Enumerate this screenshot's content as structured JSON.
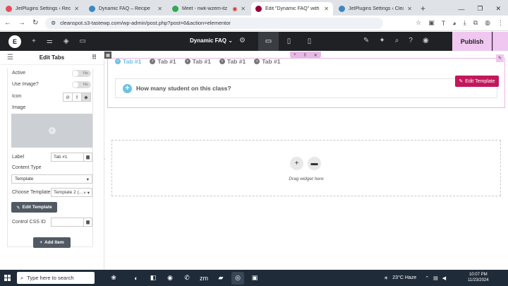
{
  "browser": {
    "tabs": [
      {
        "title": "JetPlugins Settings › Recipe",
        "color": "#e54e59",
        "active": false
      },
      {
        "title": "Dynamic FAQ – Recipe",
        "color": "#3b88c3",
        "active": false
      },
      {
        "title": "Meet - nwk-wzem-itz",
        "color": "#34a853",
        "active": false
      },
      {
        "title": "Edit \"Dynamic FAQ\" with Ele",
        "color": "#92003b",
        "active": true
      },
      {
        "title": "JetPlugins Settings ‹ Clean S",
        "color": "#3b88c3",
        "active": false
      }
    ],
    "url": "cleanspot.s3-tastewp.com/wp-admin/post.php?post=6&action=elementor"
  },
  "editor": {
    "document_name": "Dynamic FAQ",
    "publish_label": "Publish"
  },
  "panel": {
    "title": "Edit Tabs",
    "active_label": "Active",
    "active_toggle": "No",
    "use_image_label": "Use Image?",
    "use_image_toggle": "No",
    "icon_label": "Icon",
    "image_label": "Image",
    "label_label": "Label",
    "label_value": "Tab #1",
    "content_type_label": "Content Type",
    "content_type_value": "Template",
    "choose_template_label": "Choose Template",
    "choose_template_value": "Template 2 (...",
    "edit_template_label": "Edit Template",
    "control_css_label": "Control CSS ID",
    "add_item_label": "Add Item"
  },
  "canvas": {
    "tabs": [
      "Tab #1",
      "Tab #1",
      "Tab #1",
      "Tab #1",
      "Tab #1"
    ],
    "question": "How many student on this class?",
    "edit_template_label": "Edit Template",
    "drag_hint": "Drag widget here"
  },
  "taskbar": {
    "search_placeholder": "Type here to search",
    "weather": "23°C  Haze",
    "time": "10:07 PM",
    "date": "11/23/2024"
  }
}
